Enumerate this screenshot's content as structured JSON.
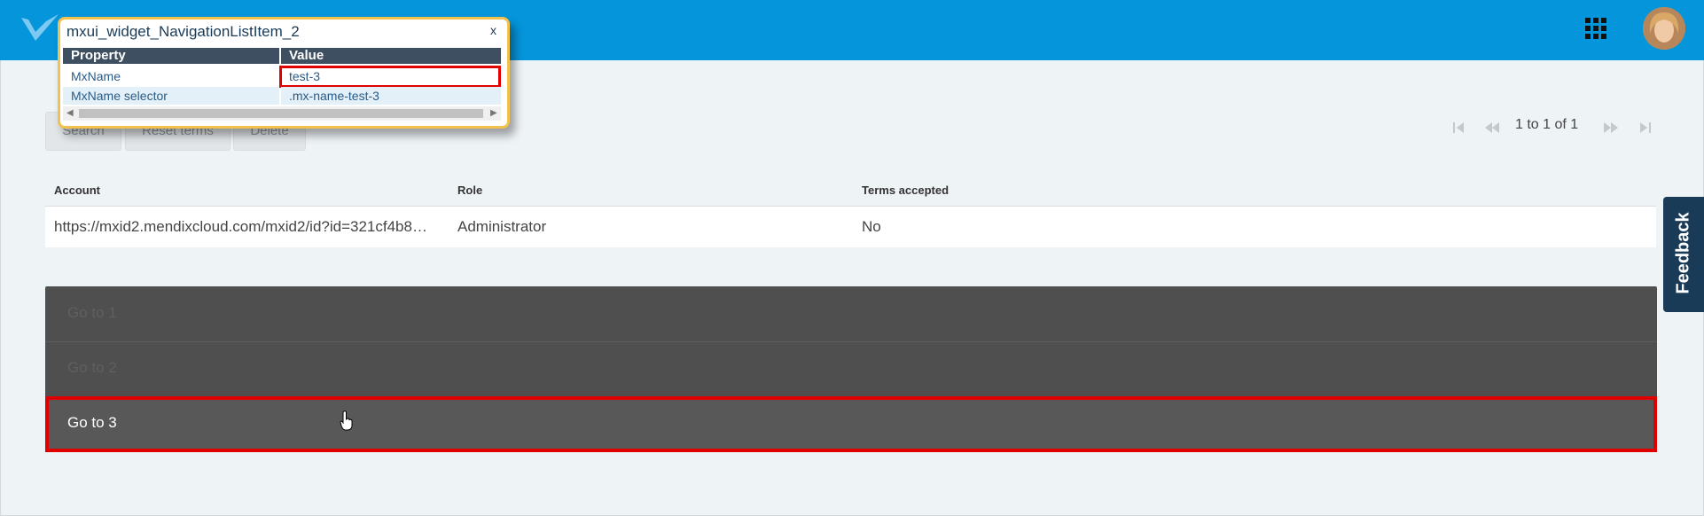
{
  "popup": {
    "title": "mxui_widget_NavigationListItem_2",
    "close": "x",
    "headers": [
      "Property",
      "Value"
    ],
    "rows": [
      {
        "property": "MxName",
        "value": "test-3"
      },
      {
        "property": "MxName selector",
        "value": ".mx-name-test-3"
      }
    ]
  },
  "toolbar": {
    "search_label": "Search",
    "reset_label": "Reset terms",
    "delete_label": "Delete"
  },
  "pager": {
    "text": "1 to 1 of 1"
  },
  "grid": {
    "headers": [
      "Account",
      "Role",
      "Terms accepted"
    ],
    "rows": [
      {
        "account": "https://mxid2.mendixcloud.com/mxid2/id?id=321cf4b8…",
        "role": "Administrator",
        "terms": "No"
      }
    ]
  },
  "navlist": {
    "items": [
      "Go to 1",
      "Go to 2",
      "Go to 3"
    ],
    "active_index": 2
  },
  "feedback": {
    "label": "Feedback"
  },
  "colors": {
    "topbar": "#0595db",
    "highlight": "#e00000",
    "popup_border": "#f2c14e",
    "feedback_bg": "#1a3b57"
  }
}
